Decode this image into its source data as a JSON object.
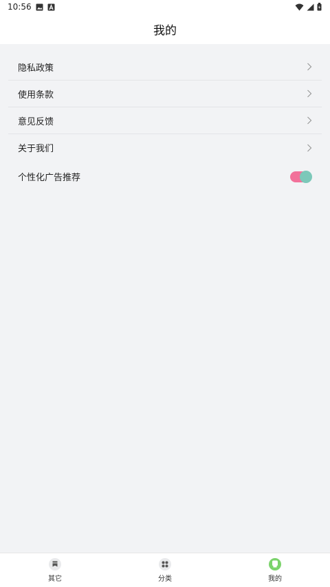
{
  "status_bar": {
    "time": "10:56",
    "icons": [
      "image-icon",
      "notification-a-icon",
      "wifi-icon",
      "signal-icon",
      "battery-icon"
    ]
  },
  "header": {
    "title": "我的"
  },
  "menu": {
    "items": [
      {
        "label": "隐私政策",
        "icon": "chevron-right-icon"
      },
      {
        "label": "使用条款",
        "icon": "chevron-right-icon"
      },
      {
        "label": "意见反馈",
        "icon": "chevron-right-icon"
      },
      {
        "label": "关于我们",
        "icon": "chevron-right-icon"
      }
    ],
    "ad_toggle": {
      "label": "个性化广告推荐",
      "on": true
    }
  },
  "tabbar": {
    "tabs": [
      {
        "label": "其它",
        "icon": "bookmark-icon",
        "active": false
      },
      {
        "label": "分类",
        "icon": "grid-icon",
        "active": false
      },
      {
        "label": "我的",
        "icon": "profile-icon",
        "active": true
      }
    ]
  },
  "colors": {
    "background": "#f2f3f5",
    "toggle_track": "#f2719a",
    "toggle_knob": "#7cc8b9",
    "active_tab": "#7bd36b"
  }
}
